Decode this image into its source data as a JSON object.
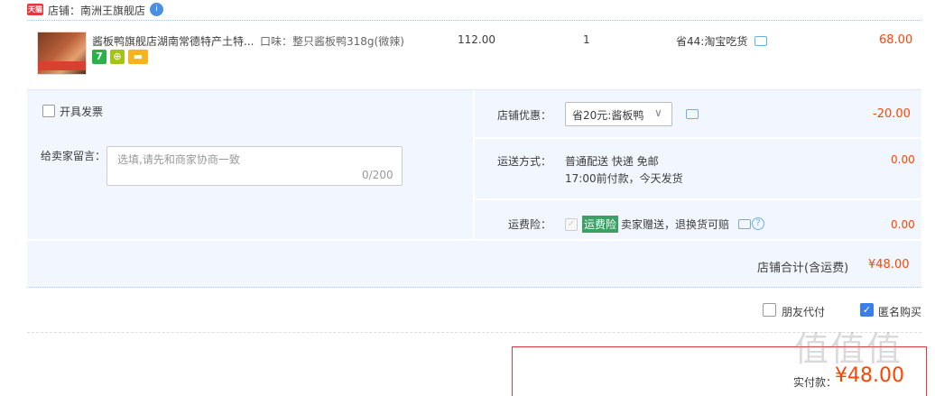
{
  "shop": {
    "badge": "天猫",
    "name": "店铺：南洲王旗舰店",
    "chat_icon": "chat-bubble-icon"
  },
  "item": {
    "title": "酱板鸭旗舰店湖南常德特产土特...",
    "spec": "口味：整只酱板鸭318g(微辣)",
    "services": [
      "7",
      "⊕",
      "▬"
    ],
    "price": "112.00",
    "quantity": "1",
    "promo": "省44:淘宝吃货",
    "subtotal": "68.00"
  },
  "invoice": {
    "label": "开具发票"
  },
  "message": {
    "label": "给卖家留言：",
    "placeholder": "选填,请先和商家协商一致",
    "counter": "0/200"
  },
  "shop_discount": {
    "label": "店铺优惠：",
    "selected": "省20元:酱板鸭",
    "value": "-20.00"
  },
  "shipping": {
    "label": "运送方式：",
    "line1": "普通配送 快递 免邮",
    "line2": "17:00前付款，今天发货",
    "value": "0.00"
  },
  "insurance": {
    "label": "运费险：",
    "badge": "运费险",
    "text": "卖家赠送，退换货可赔",
    "value": "0.00"
  },
  "shop_total": {
    "label": "店铺合计(含运费)",
    "value": "¥48.00"
  },
  "options": {
    "friend_pay": "朋友代付",
    "anonymous": "匿名购买"
  },
  "payment": {
    "label": "实付款：",
    "value": "¥48.00"
  },
  "watermark": "值值值"
}
